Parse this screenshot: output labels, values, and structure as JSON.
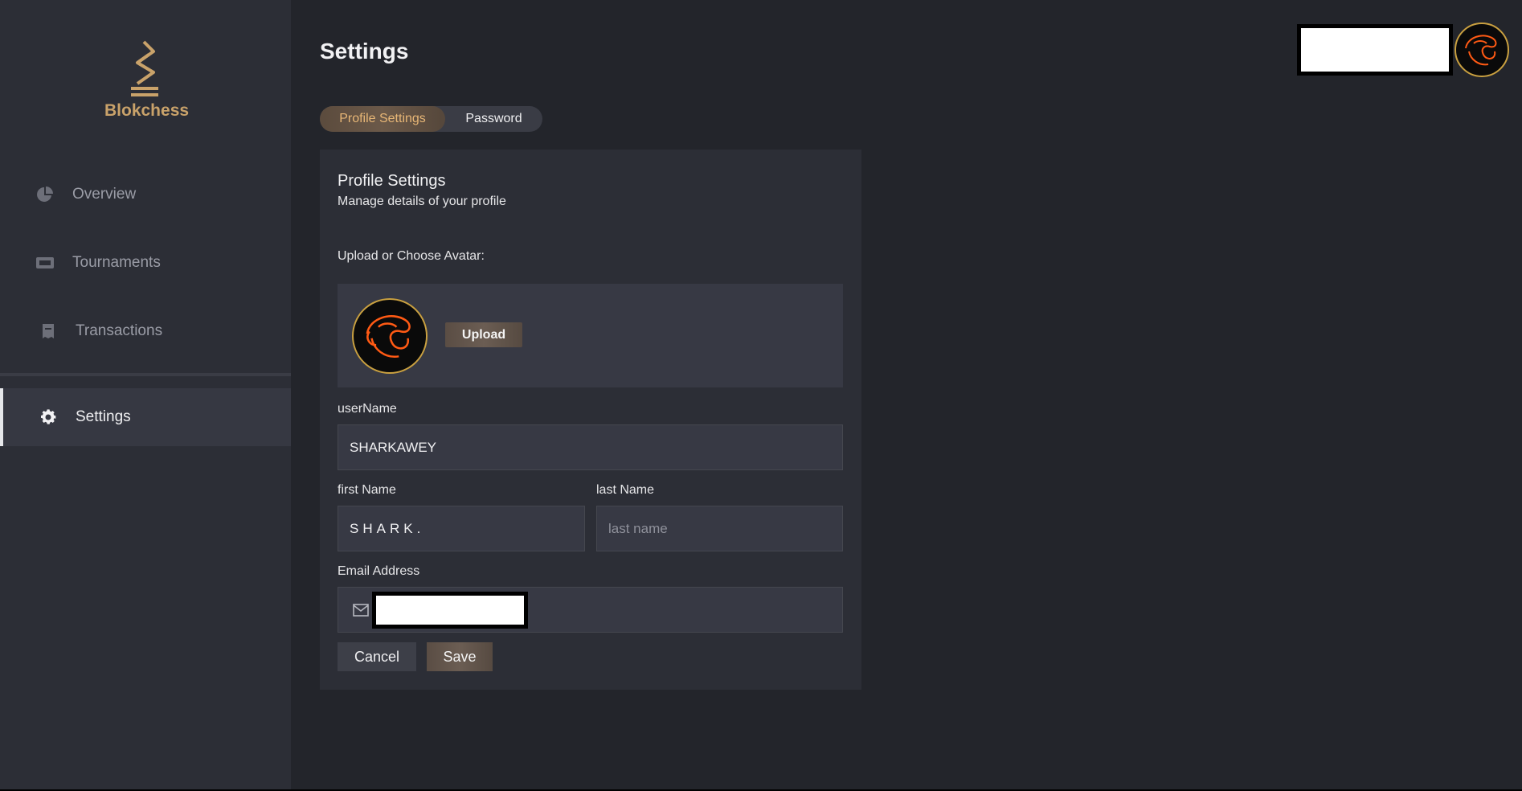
{
  "brand": {
    "name": "Blokchess",
    "accent": "#c9a26a"
  },
  "sidebar": {
    "items": [
      {
        "label": "Overview",
        "icon": "pie-chart-icon"
      },
      {
        "label": "Tournaments",
        "icon": "ticket-icon"
      },
      {
        "label": "Transactions",
        "icon": "receipt-icon"
      },
      {
        "label": "Settings",
        "icon": "gear-icon",
        "active": true
      }
    ]
  },
  "header": {
    "title": "Settings"
  },
  "tabs": [
    {
      "label": "Profile Settings",
      "active": true
    },
    {
      "label": "Password",
      "active": false
    }
  ],
  "profile": {
    "title": "Profile Settings",
    "subtitle": "Manage details of your profile",
    "avatar_label": "Upload or Choose Avatar:",
    "upload_label": "Upload",
    "username_label": "userName",
    "username_value": "SHARKAWEY",
    "first_name_label": "first Name",
    "first_name_value": "SHARK.",
    "last_name_label": "last Name",
    "last_name_placeholder": "last name",
    "email_label": "Email Address",
    "cancel_label": "Cancel",
    "save_label": "Save"
  }
}
